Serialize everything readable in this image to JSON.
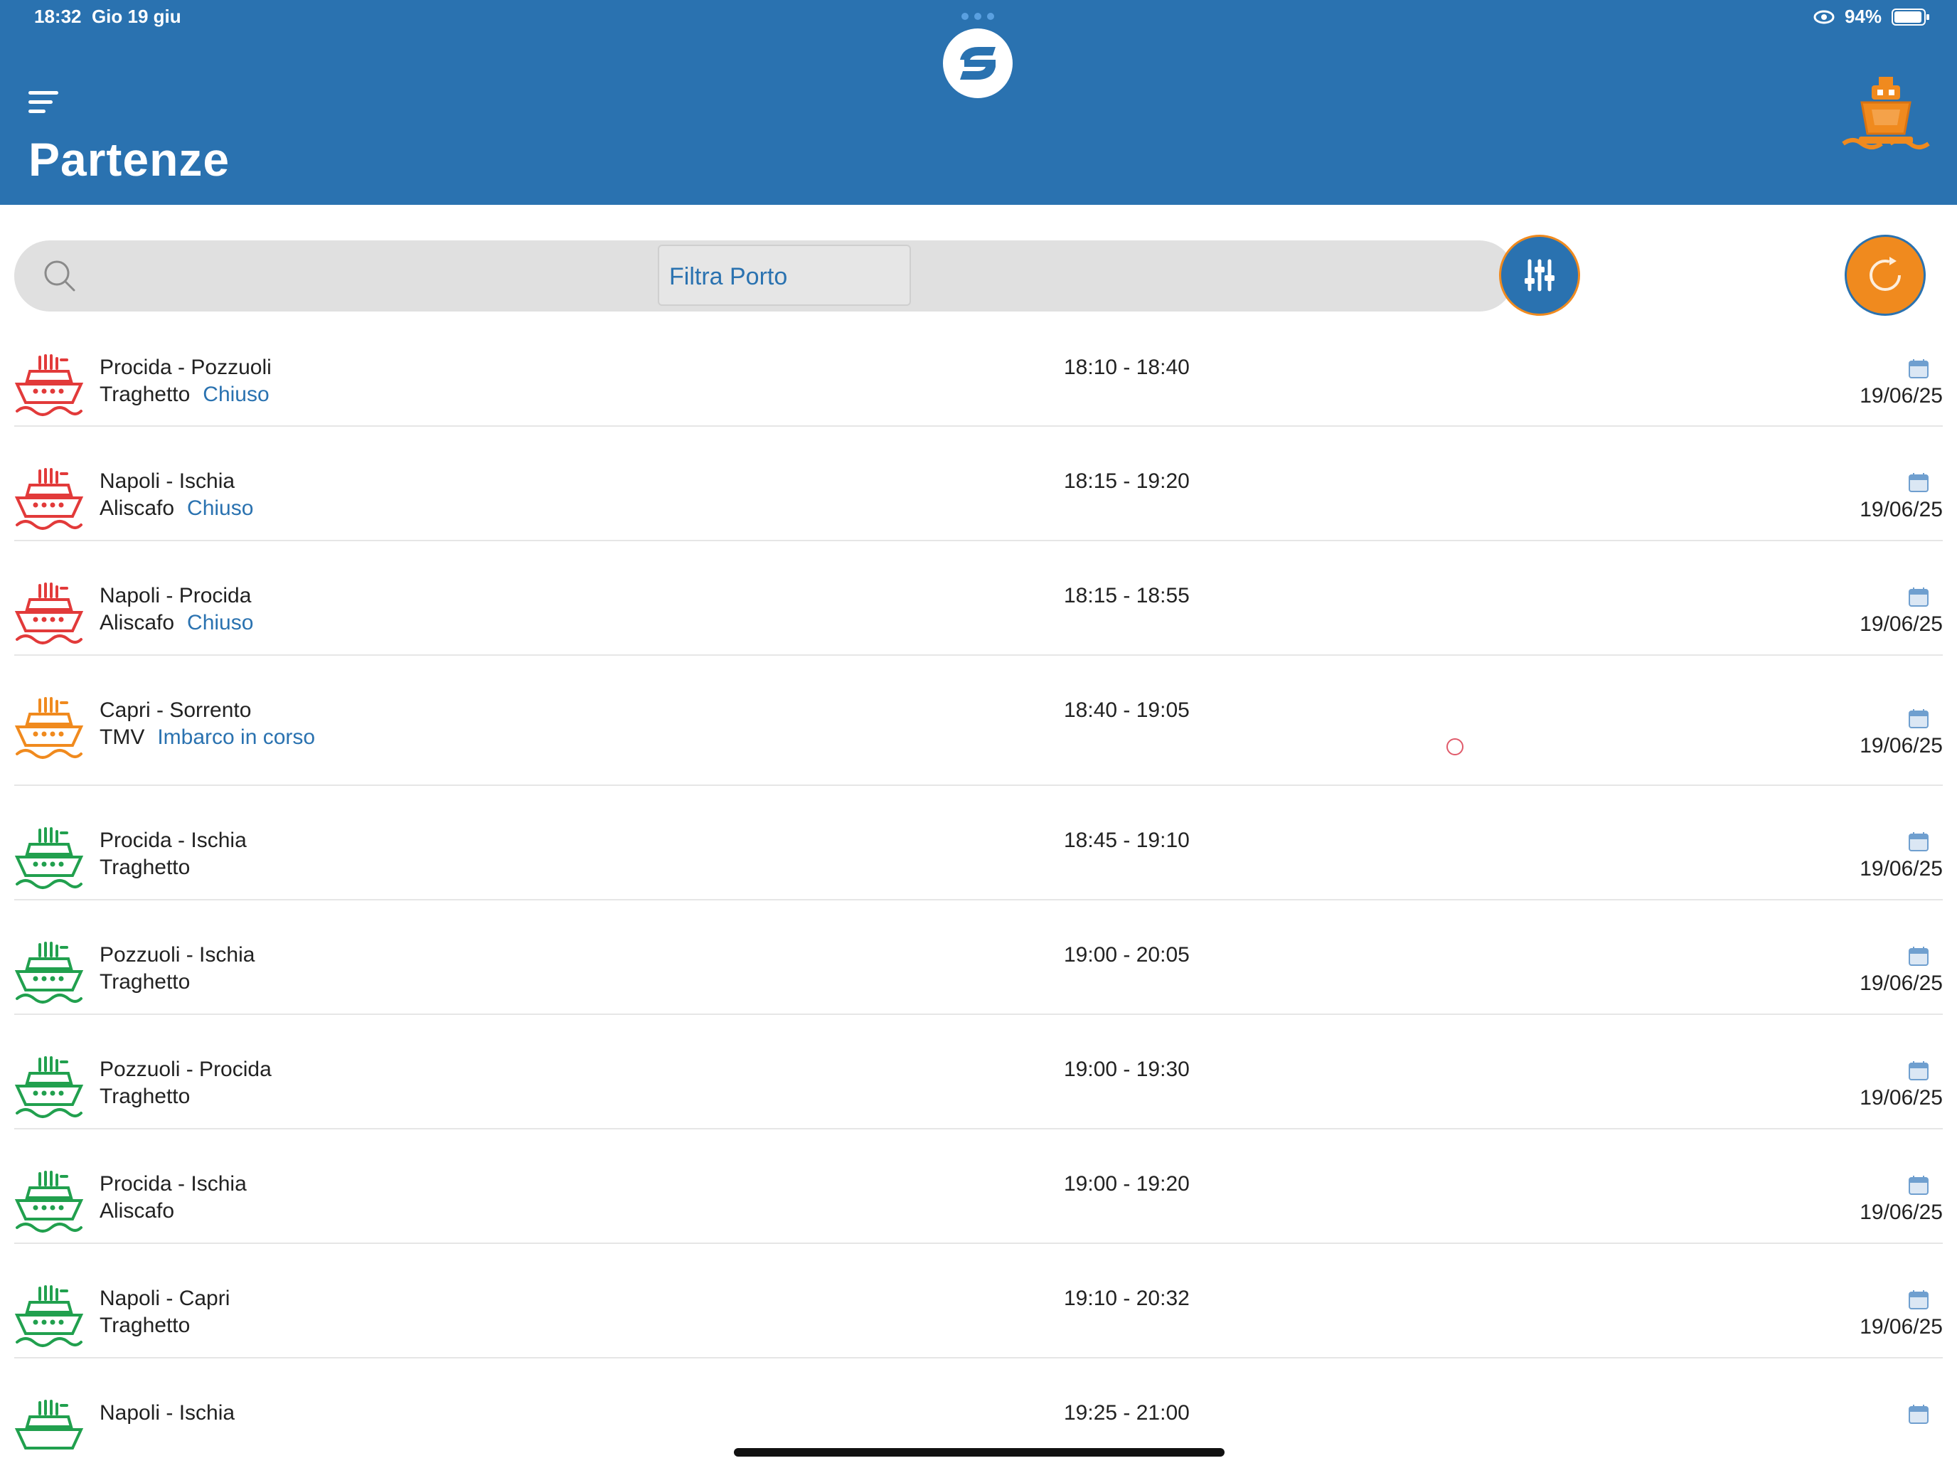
{
  "status_bar": {
    "time": "18:32",
    "date": "Gio 19 giu",
    "battery": "94%"
  },
  "header": {
    "title": "Partenze"
  },
  "search": {
    "filter_label": "Filtra Porto"
  },
  "colors": {
    "header_bg": "#2A72B0",
    "accent": "#F08A1E",
    "closed": "#E23A3A",
    "boarding": "#F08A1E",
    "open": "#21A04E"
  },
  "departures": [
    {
      "route": "Procida - Pozzuoli",
      "type": "Traghetto",
      "status": "Chiuso",
      "times": "18:10 - 18:40",
      "date": "19/06/25",
      "icon": "ship-icon-red"
    },
    {
      "route": "Napoli - Ischia",
      "type": "Aliscafo",
      "status": "Chiuso",
      "times": "18:15 - 19:20",
      "date": "19/06/25",
      "icon": "ship-icon-red"
    },
    {
      "route": "Napoli - Procida",
      "type": "Aliscafo",
      "status": "Chiuso",
      "times": "18:15 - 18:55",
      "date": "19/06/25",
      "icon": "ship-icon-red"
    },
    {
      "route": "Capri - Sorrento",
      "type": "TMV",
      "status": "Imbarco in corso",
      "times": "18:40 - 19:05",
      "date": "19/06/25",
      "icon": "ship-icon-orange"
    },
    {
      "route": "Procida - Ischia",
      "type": "Traghetto",
      "status": "",
      "times": "18:45 - 19:10",
      "date": "19/06/25",
      "icon": "ship-icon-green"
    },
    {
      "route": "Pozzuoli - Ischia",
      "type": "Traghetto",
      "status": "",
      "times": "19:00 - 20:05",
      "date": "19/06/25",
      "icon": "ship-icon-green"
    },
    {
      "route": "Pozzuoli - Procida",
      "type": "Traghetto",
      "status": "",
      "times": "19:00 - 19:30",
      "date": "19/06/25",
      "icon": "ship-icon-green"
    },
    {
      "route": "Procida - Ischia",
      "type": "Aliscafo",
      "status": "",
      "times": "19:00 - 19:20",
      "date": "19/06/25",
      "icon": "ship-icon-green"
    },
    {
      "route": "Napoli - Capri",
      "type": "Traghetto",
      "status": "",
      "times": "19:10 - 20:32",
      "date": "19/06/25",
      "icon": "ship-icon-green"
    },
    {
      "route": "Napoli - Ischia",
      "type": "",
      "status": "",
      "times": "19:25 - 21:00",
      "date": "",
      "icon": "ship-icon-green"
    }
  ]
}
